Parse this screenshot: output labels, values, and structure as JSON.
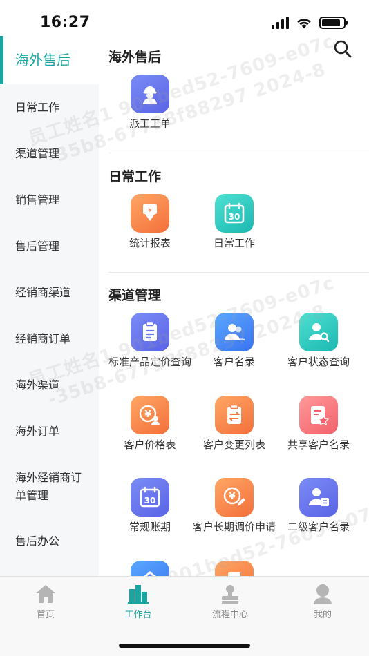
{
  "status_bar": {
    "time": "16:27"
  },
  "sidebar": {
    "items": [
      {
        "label": "海外售后",
        "active": true
      },
      {
        "label": "日常工作"
      },
      {
        "label": "渠道管理"
      },
      {
        "label": "销售管理"
      },
      {
        "label": "售后管理"
      },
      {
        "label": "经销商渠道"
      },
      {
        "label": "经销商订单"
      },
      {
        "label": "海外渠道"
      },
      {
        "label": "海外订单"
      },
      {
        "label": "海外经销商订单管理"
      },
      {
        "label": "售后办公"
      }
    ]
  },
  "main": {
    "search_icon": "search-icon",
    "sections": [
      {
        "title": "海外售后",
        "tiles": [
          {
            "label": "派工工单",
            "icon": "worker-icon",
            "color": "#6b78ef"
          }
        ]
      },
      {
        "title": "日常工作",
        "tiles": [
          {
            "label": "统计报表",
            "icon": "download-report-icon",
            "color": "#f7864a"
          },
          {
            "label": "日常工作",
            "icon": "calendar-30-icon",
            "color": "#2cc8bf"
          }
        ]
      },
      {
        "title": "渠道管理",
        "tiles": [
          {
            "label": "标准产品定价查询",
            "icon": "clipboard-icon",
            "color": "#6b78ef"
          },
          {
            "label": "客户名录",
            "icon": "contacts-icon",
            "color": "#4a88f6"
          },
          {
            "label": "客户状态查询",
            "icon": "user-search-icon",
            "color": "#2cc8bf"
          },
          {
            "label": "客户价格表",
            "icon": "yen-user-icon",
            "color": "#f7864a"
          },
          {
            "label": "客户变更列表",
            "icon": "transfer-clipboard-icon",
            "color": "#f7864a"
          },
          {
            "label": "共享客户名录",
            "icon": "star-document-icon",
            "color": "#f57a7c"
          },
          {
            "label": "常规账期",
            "icon": "calendar-30-icon",
            "color": "#6b78ef"
          },
          {
            "label": "客户长期调价申请",
            "icon": "yen-edit-icon",
            "color": "#f7864a"
          },
          {
            "label": "二级客户名录",
            "icon": "user-card-icon",
            "color": "#6b78ef"
          }
        ]
      }
    ]
  },
  "tabbar": {
    "tabs": [
      {
        "label": "首页",
        "icon": "home-icon"
      },
      {
        "label": "工作台",
        "icon": "workbench-icon",
        "active": true
      },
      {
        "label": "流程中心",
        "icon": "stamp-icon"
      },
      {
        "label": "我的",
        "icon": "profile-icon"
      }
    ]
  },
  "colors": {
    "accent": "#1aa5a0",
    "sidebar_bg": "#f6f7f9"
  }
}
